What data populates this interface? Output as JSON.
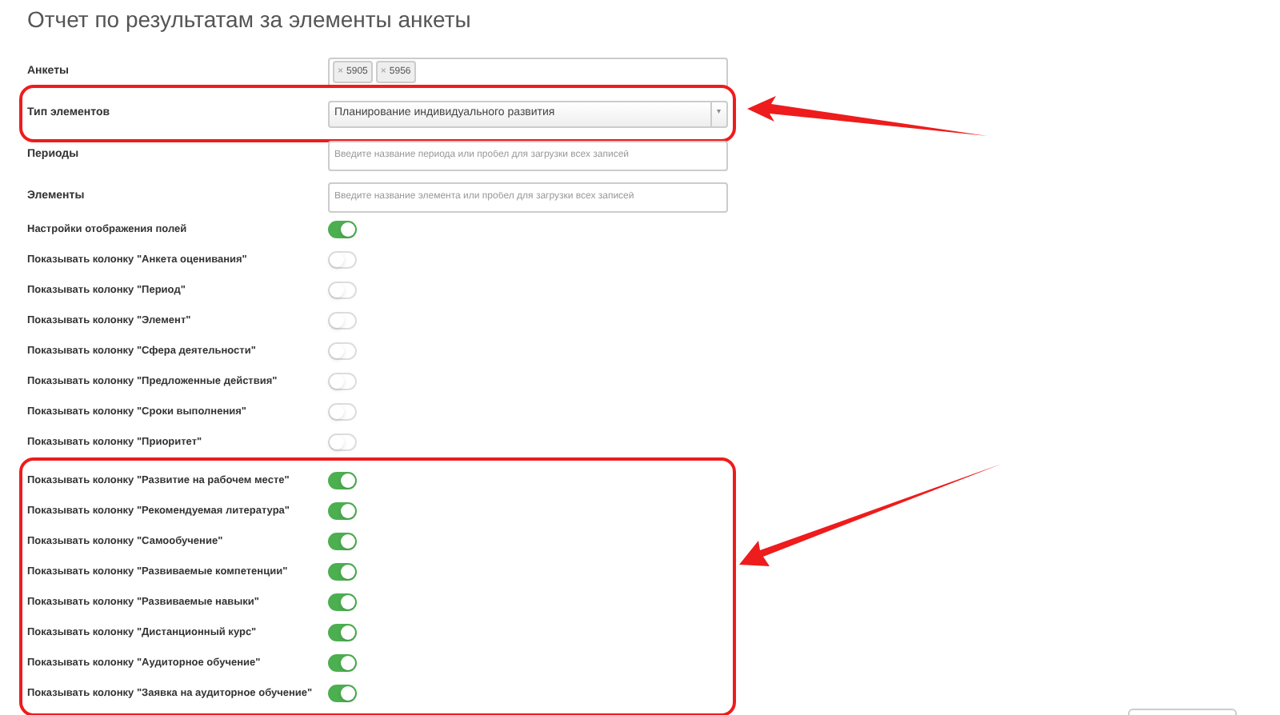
{
  "title": "Отчет по результатам за элементы анкеты",
  "fields": [
    {
      "kind": "tags",
      "label": "Анкеты",
      "highlighted": false,
      "tags": [
        {
          "remove": "×",
          "text": "5905"
        },
        {
          "remove": "×",
          "text": "5956"
        }
      ]
    },
    {
      "kind": "select",
      "label": "Тип элементов",
      "highlighted": true,
      "value": "Планирование индивидуального развития",
      "caret": "▾"
    },
    {
      "kind": "text",
      "label": "Периоды",
      "highlighted": false,
      "placeholder": "Введите название периода или пробел для загрузки всех записей"
    },
    {
      "kind": "text",
      "label": "Элементы",
      "highlighted": false,
      "placeholder": "Введите название элемента или пробел для загрузки всех записей"
    }
  ],
  "toggle_groups": [
    {
      "highlighted": false,
      "rows": [
        {
          "label": "Настройки отображения полей",
          "on": true
        },
        {
          "label": "Показывать колонку \"Анкета оценивания\"",
          "on": false
        },
        {
          "label": "Показывать колонку \"Период\"",
          "on": false
        },
        {
          "label": "Показывать колонку \"Элемент\"",
          "on": false
        },
        {
          "label": "Показывать колонку \"Сфера деятельности\"",
          "on": false
        },
        {
          "label": "Показывать колонку \"Предложенные действия\"",
          "on": false
        },
        {
          "label": "Показывать колонку \"Сроки выполнения\"",
          "on": false
        },
        {
          "label": "Показывать колонку \"Приоритет\"",
          "on": false
        }
      ]
    },
    {
      "highlighted": true,
      "rows": [
        {
          "label": "Показывать колонку \"Развитие на рабочем месте\"",
          "on": true
        },
        {
          "label": "Показывать колонку \"Рекомендуемая литература\"",
          "on": true
        },
        {
          "label": "Показывать колонку \"Самообучение\"",
          "on": true
        },
        {
          "label": "Показывать колонку \"Развиваемые компетенции\"",
          "on": true
        },
        {
          "label": "Показывать колонку \"Развиваемые навыки\"",
          "on": true
        },
        {
          "label": "Показывать колонку \"Дистанционный курс\"",
          "on": true
        },
        {
          "label": "Показывать колонку \"Аудиторное обучение\"",
          "on": true
        },
        {
          "label": "Показывать колонку \"Заявка на аудиторное обучение\"",
          "on": true
        }
      ]
    }
  ]
}
